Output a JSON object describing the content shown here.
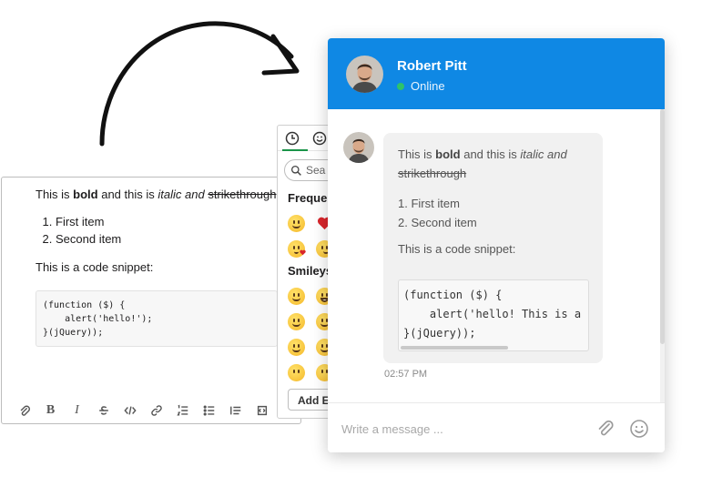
{
  "editor": {
    "text_prefix": "This is ",
    "bold_word": "bold",
    "text_middle": " and this is ",
    "italic_words": "italic and",
    "space": " ",
    "strike_word": "strikethrough",
    "list_items": [
      "First item",
      "Second item"
    ],
    "code_label": "This is a code snippet:",
    "code": "(function ($) {\n    alert('hello!');\n}(jQuery));"
  },
  "toolbar": {
    "icons": [
      "paperclip-icon",
      "bold-icon",
      "italic-icon",
      "strikethrough-icon",
      "code-icon",
      "link-icon",
      "ordered-list-icon",
      "bullet-list-icon",
      "blockquote-icon",
      "code-block-icon"
    ],
    "bold": "B",
    "italic": "I"
  },
  "emoji_picker": {
    "search_placeholder": "Sea",
    "category_frequent": "Frequen",
    "category_smileys": "Smileys",
    "add_button": "Add Em"
  },
  "chat": {
    "contact_name": "Robert Pitt",
    "status": "Online",
    "message": {
      "text_prefix": "This is ",
      "bold_word": "bold",
      "text_middle": " and this is ",
      "italic_words": "italic and",
      "space": " ",
      "strike_word": "strikethrough",
      "list_items": [
        "1. First item",
        "2. Second item"
      ],
      "code_label": "This is a code snippet:",
      "code": "(function ($) {\n    alert('hello! This is a\n}(jQuery));"
    },
    "time": "02:57 PM",
    "input_placeholder": "Write a message ..."
  },
  "colors": {
    "header_blue": "#0f88e4",
    "online_green": "#2ec36a",
    "picker_active": "#1a9449",
    "bubble_bg": "#f1f1f1"
  }
}
